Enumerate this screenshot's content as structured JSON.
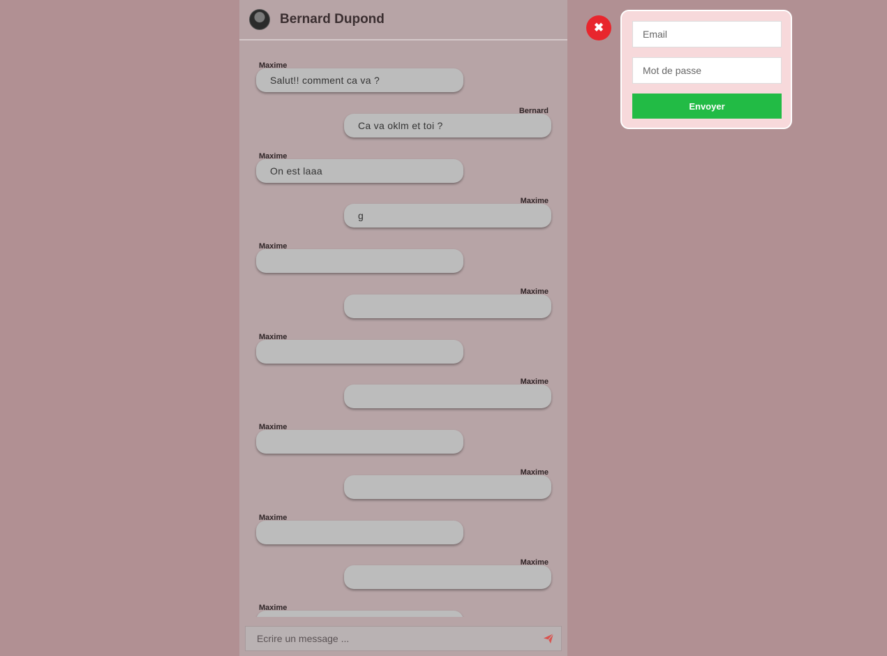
{
  "header": {
    "contact_name": "Bernard Dupond",
    "avatar_icon": "user-avatar"
  },
  "messages": [
    {
      "side": "left",
      "sender": "Maxime",
      "text": "Salut!! comment ca va ?"
    },
    {
      "side": "right",
      "sender": "Bernard",
      "text": "Ca va oklm et toi ?"
    },
    {
      "side": "left",
      "sender": "Maxime",
      "text": "On est laaa"
    },
    {
      "side": "right",
      "sender": "Maxime",
      "text": "g"
    },
    {
      "side": "left",
      "sender": "Maxime",
      "text": ""
    },
    {
      "side": "right",
      "sender": "Maxime",
      "text": ""
    },
    {
      "side": "left",
      "sender": "Maxime",
      "text": ""
    },
    {
      "side": "right",
      "sender": "Maxime",
      "text": ""
    },
    {
      "side": "left",
      "sender": "Maxime",
      "text": ""
    },
    {
      "side": "right",
      "sender": "Maxime",
      "text": ""
    },
    {
      "side": "left",
      "sender": "Maxime",
      "text": ""
    },
    {
      "side": "right",
      "sender": "Maxime",
      "text": ""
    },
    {
      "side": "left",
      "sender": "Maxime",
      "text": ""
    }
  ],
  "composer": {
    "placeholder": "Ecrire un message ...",
    "send_icon": "paper-plane-icon"
  },
  "login": {
    "email_placeholder": "Email",
    "password_placeholder": "Mot de passe",
    "submit_label": "Envoyer",
    "close_icon": "close-icon",
    "close_glyph": "✖"
  },
  "colors": {
    "background": "#b19093",
    "chat_panel": "#b7a4a6",
    "bubble": "#bcbcbc",
    "submit": "#22bb45",
    "close": "#e8262d",
    "send_icon": "#d9534f",
    "login_card": "#f7d9db"
  }
}
